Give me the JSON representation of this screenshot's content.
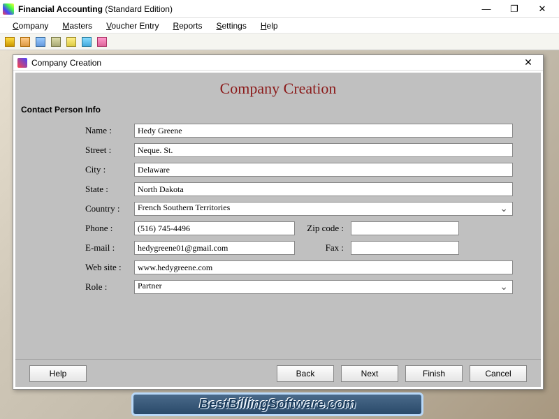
{
  "app": {
    "title_bold": "Financial Accounting",
    "title_paren": " (Standard Edition)"
  },
  "menu": {
    "company": "Company",
    "company_u": "C",
    "masters": "Masters",
    "masters_u": "M",
    "voucher": "Voucher Entry",
    "voucher_u": "V",
    "reports": "Reports",
    "reports_u": "R",
    "settings": "Settings",
    "settings_u": "S",
    "help": "Help",
    "help_u": "H"
  },
  "dialog": {
    "title": "Company Creation",
    "heading": "Company Creation",
    "section": "Contact Person Info",
    "labels": {
      "name": "Name :",
      "street": "Street :",
      "city": "City :",
      "state": "State :",
      "country": "Country :",
      "phone": "Phone :",
      "zip": "Zip code :",
      "email": "E-mail :",
      "fax": "Fax :",
      "website": "Web site :",
      "role": "Role :"
    },
    "values": {
      "name": "Hedy Greene",
      "street": "Neque. St.",
      "city": "Delaware",
      "state": "North Dakota",
      "country": "French Southern Territories",
      "phone": "(516) 745-4496",
      "zip": "",
      "email": "hedygreene01@gmail.com",
      "fax": "",
      "website": "www.hedygreene.com",
      "role": "Partner"
    },
    "buttons": {
      "help": "Help",
      "back": "Back",
      "next": "Next",
      "finish": "Finish",
      "cancel": "Cancel"
    }
  },
  "banner": "BestBillingSoftware.com"
}
